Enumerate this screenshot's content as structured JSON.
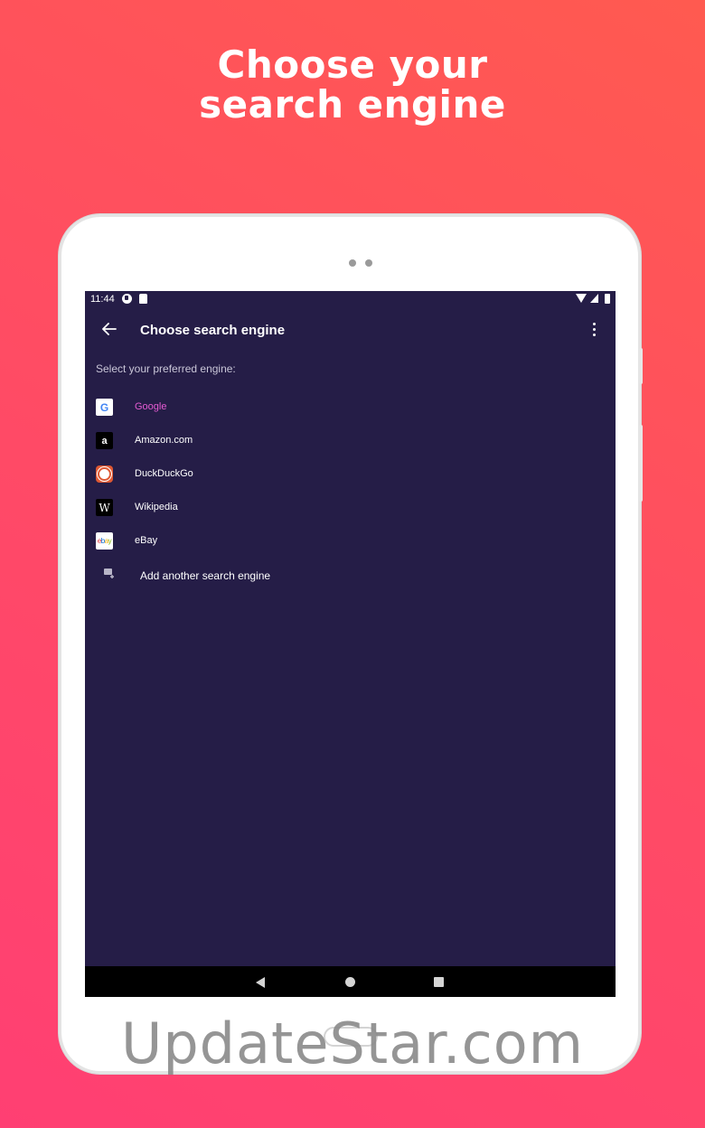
{
  "promo": {
    "headline_line1": "Choose your",
    "headline_line2": "search engine"
  },
  "status_bar": {
    "time": "11:44",
    "icons": [
      "sync-icon",
      "sd-card-icon",
      "wifi-icon",
      "signal-icon",
      "battery-icon"
    ]
  },
  "app_bar": {
    "title": "Choose search engine",
    "back_icon": "arrow-left-icon",
    "menu_icon": "more-vert-icon"
  },
  "prompt": "Select your preferred engine:",
  "engines": [
    {
      "label": "Google",
      "icon": "google-icon",
      "selected": true
    },
    {
      "label": "Amazon.com",
      "icon": "amazon-icon",
      "selected": false
    },
    {
      "label": "DuckDuckGo",
      "icon": "duckduckgo-icon",
      "selected": false
    },
    {
      "label": "Wikipedia",
      "icon": "wikipedia-icon",
      "selected": false
    },
    {
      "label": "eBay",
      "icon": "ebay-icon",
      "selected": false
    }
  ],
  "add_engine": {
    "label": "Add another search engine",
    "icon": "add-search-icon"
  },
  "icon_glyphs": {
    "google": "G",
    "amazon": "a",
    "wikipedia": "W",
    "ebay": [
      "e",
      "b",
      "a",
      "y"
    ]
  },
  "watermark": "UpdateStar.com",
  "colors": {
    "screen_bg": "#251d47",
    "selected_text": "#e45bd2",
    "gradient_start": "#ff3f73",
    "gradient_end": "#ff5a50"
  }
}
